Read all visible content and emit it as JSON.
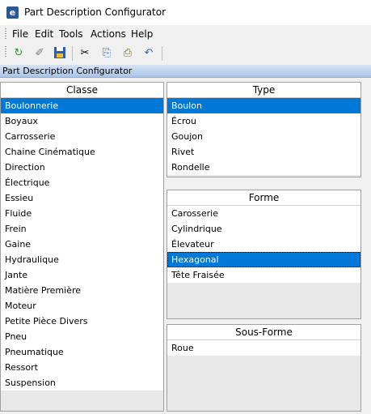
{
  "window": {
    "title": "Part Description Configurator"
  },
  "menu": [
    "File",
    "Edit",
    "Tools",
    "Actions",
    "Help"
  ],
  "toolbar": {
    "icons": [
      "refresh-icon",
      "eraser-icon",
      "save-icon",
      "cut-icon",
      "copy-icon",
      "paste-icon",
      "undo-icon"
    ]
  },
  "panel": {
    "title": "Part Description Configurator"
  },
  "classe": {
    "header": "Classe",
    "selected_index": 0,
    "items": [
      "Boulonnerie",
      "Boyaux",
      "Carrosserie",
      "Chaine Cinématique",
      "Direction",
      "Électrique",
      "Essieu",
      "Fluide",
      "Frein",
      "Gaine",
      "Hydraulique",
      "Jante",
      "Matière Première",
      "Moteur",
      "Petite Pièce Divers",
      "Pneu",
      "Pneumatique",
      "Ressort",
      "Suspension"
    ]
  },
  "type": {
    "header": "Type",
    "selected_index": 0,
    "items": [
      "Boulon",
      "Écrou",
      "Goujon",
      "Rivet",
      "Rondelle"
    ]
  },
  "forme": {
    "header": "Forme",
    "selected_index": 3,
    "items": [
      "Carosserie",
      "Cylindrique",
      "Élevateur",
      "Hexagonal",
      "Tête Fraisée"
    ]
  },
  "sous_forme": {
    "header": "Sous-Forme",
    "items": [
      "Roue"
    ]
  },
  "colors": {
    "selection": "#0078d7",
    "panel_bar": "#b8cfee"
  }
}
